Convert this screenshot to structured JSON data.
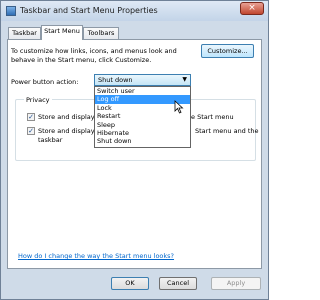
{
  "window": {
    "title": "Taskbar and Start Menu Properties",
    "close_glyph": "×"
  },
  "tabs": [
    {
      "label": "Taskbar"
    },
    {
      "label": "Start Menu"
    },
    {
      "label": "Toolbars"
    }
  ],
  "start_menu": {
    "description": "To customize how links, icons, and menus look and behave in the Start menu, click Customize.",
    "customize_label": "Customize...",
    "power_label": "Power button action:",
    "power_value": "Shut down",
    "dropdown_options": [
      "Switch user",
      "Log off",
      "Lock",
      "Restart",
      "Sleep",
      "Hibernate",
      "Shut down"
    ],
    "selected_option_index": 1,
    "privacy_label": "Privacy",
    "privacy_items": [
      {
        "left_text": "Store and display r",
        "right_text": "e Start menu",
        "checked": true
      },
      {
        "left_text": "Store and display r",
        "right_text": "Start menu and the",
        "continuation": "taskbar",
        "checked": true
      }
    ],
    "help_link": "How do I change the way the Start menu looks?"
  },
  "buttons": {
    "ok": "OK",
    "cancel": "Cancel",
    "apply": "Apply"
  }
}
